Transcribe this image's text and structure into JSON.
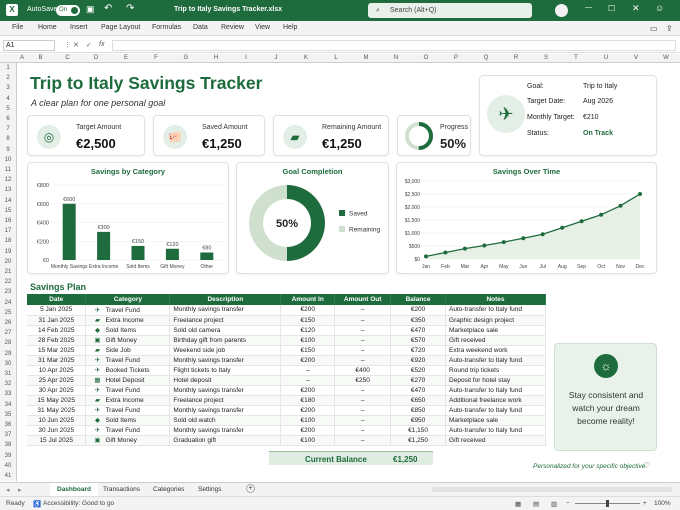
{
  "titlebar": {
    "autosave_label": "AutoSave",
    "autosave_state": "On",
    "file_name": "Trip to Italy Savings Tracker.xlsx",
    "search_placeholder": "Search (Alt+Q)"
  },
  "ribbon": {
    "tabs": [
      "File",
      "Home",
      "Insert",
      "Page Layout",
      "Formulas",
      "Data",
      "Review",
      "View",
      "Help"
    ]
  },
  "formula_bar": {
    "cell_ref": "A1",
    "fx": "fx"
  },
  "columns": [
    "A",
    "B",
    "C",
    "D",
    "E",
    "F",
    "G",
    "H",
    "I",
    "J",
    "K",
    "L",
    "M",
    "N",
    "O",
    "P",
    "Q",
    "R",
    "S",
    "T",
    "U",
    "V",
    "W",
    "X",
    "Y"
  ],
  "rows": [
    "1",
    "2",
    "3",
    "4",
    "5",
    "6",
    "7",
    "8",
    "9",
    "10",
    "11",
    "12",
    "13",
    "14",
    "15",
    "16",
    "17",
    "18",
    "19",
    "20",
    "21",
    "22",
    "23",
    "24",
    "25",
    "26",
    "27",
    "28",
    "29",
    "30",
    "31",
    "32",
    "33",
    "34",
    "35",
    "36",
    "37",
    "38",
    "39",
    "40",
    "41"
  ],
  "header": {
    "title": "Trip to Italy Savings Tracker",
    "subtitle": "A clear plan for one personal goal"
  },
  "kpis": [
    {
      "label": "Target Amount",
      "value": "€2,500",
      "icon": "target-icon"
    },
    {
      "label": "Saved Amount",
      "value": "€1,250",
      "icon": "piggy-bank-icon"
    },
    {
      "label": "Remaining Amount",
      "value": "€1,250",
      "icon": "wallet-icon"
    }
  ],
  "progress": {
    "label": "Progress",
    "value": "50%",
    "fraction": 0.5
  },
  "goal_info": {
    "icon": "airplane-icon",
    "rows": [
      {
        "label": "Goal:",
        "value": "Trip to Italy"
      },
      {
        "label": "Target Date:",
        "value": "Aug 2026"
      },
      {
        "label": "Monthly Target:",
        "value": "€210"
      },
      {
        "label": "Status:",
        "value": "On Track"
      }
    ]
  },
  "colors": {
    "brand": "#1e6b3d",
    "light": "#cfe0cf",
    "accent": "#2e7d32"
  },
  "chart_data": [
    {
      "type": "bar",
      "title": "Savings by Category",
      "categories": [
        "Monthly Savings",
        "Extra Income",
        "Sold Items",
        "Gift Money",
        "Other"
      ],
      "values": [
        600,
        300,
        150,
        120,
        80
      ],
      "data_labels": [
        "€600",
        "€300",
        "€150",
        "€120",
        "€80"
      ],
      "ylim": [
        0,
        800
      ],
      "yticks": [
        "€0",
        "€200",
        "€400",
        "€600",
        "€800"
      ]
    },
    {
      "type": "pie",
      "title": "Goal Completion",
      "center_label": "50%",
      "slices": [
        {
          "name": "Saved",
          "value": 50
        },
        {
          "name": "Remaining",
          "value": 50
        }
      ]
    },
    {
      "type": "line",
      "title": "Savings Over Time",
      "x": [
        "Jan",
        "Feb",
        "Mar",
        "Apr",
        "May",
        "Jun",
        "Jul",
        "Aug",
        "Sep",
        "Oct",
        "Nov",
        "Dec"
      ],
      "values": [
        100,
        250,
        400,
        520,
        650,
        800,
        950,
        1200,
        1450,
        1700,
        2050,
        2500
      ],
      "ylim": [
        0,
        3000
      ],
      "yticks": [
        "$0",
        "$500",
        "$1,000",
        "$1,500",
        "$2,000",
        "$2,500",
        "$3,000"
      ]
    }
  ],
  "plan": {
    "title": "Savings Plan",
    "headers": [
      "Date",
      "Category",
      "Description",
      "Amount In",
      "Amount Out",
      "Balance",
      "Notes"
    ],
    "rows": [
      [
        "5 Jan 2025",
        "Travel Fund",
        "Monthly savings transfer",
        "€200",
        "–",
        "€200",
        "Auto-transfer to Italy fund"
      ],
      [
        "31 Jan 2025",
        "Extra Income",
        "Freelance project",
        "€150",
        "–",
        "€350",
        "Graphic design project"
      ],
      [
        "14 Feb 2025",
        "Sold Items",
        "Sold old camera",
        "€120",
        "–",
        "€470",
        "Marketplace sale"
      ],
      [
        "28 Feb 2025",
        "Gift Money",
        "Birthday gift from parents",
        "€100",
        "–",
        "€570",
        "Gift received"
      ],
      [
        "15 Mar 2025",
        "Side Job",
        "Weekend side job",
        "€150",
        "–",
        "€720",
        "Extra weekend work"
      ],
      [
        "31 Mar 2025",
        "Travel Fund",
        "Monthly savings transfer",
        "€200",
        "–",
        "€920",
        "Auto-transfer to Italy fund"
      ],
      [
        "10 Apr 2025",
        "Booked Tickets",
        "Flight tickets to Italy",
        "–",
        "€400",
        "€520",
        "Round trip tickets"
      ],
      [
        "25 Apr 2025",
        "Hotel Deposit",
        "Hotel deposit",
        "–",
        "€250",
        "€270",
        "Deposit for hotel stay"
      ],
      [
        "30 Apr 2025",
        "Travel Fund",
        "Monthly savings transfer",
        "€200",
        "–",
        "€470",
        "Auto-transfer to Italy fund"
      ],
      [
        "15 May 2025",
        "Extra Income",
        "Freelance project",
        "€180",
        "–",
        "€650",
        "Additional freelance work"
      ],
      [
        "31 May 2025",
        "Travel Fund",
        "Monthly savings transfer",
        "€200",
        "–",
        "€850",
        "Auto-transfer to Italy fund"
      ],
      [
        "10 Jun 2025",
        "Sold Items",
        "Sold old watch",
        "€100",
        "–",
        "€950",
        "Marketplace sale"
      ],
      [
        "30 Jun 2025",
        "Travel Fund",
        "Monthly savings transfer",
        "€200",
        "–",
        "€1,150",
        "Auto-transfer to Italy fund"
      ],
      [
        "15 Jul 2025",
        "Gift Money",
        "Graduation gift",
        "€100",
        "–",
        "€1,250",
        "Gift received"
      ]
    ],
    "row_icons": [
      "airplane-icon",
      "briefcase-icon",
      "tag-icon",
      "gift-icon",
      "briefcase-icon",
      "airplane-icon",
      "airplane-icon",
      "hotel-icon",
      "airplane-icon",
      "briefcase-icon",
      "airplane-icon",
      "tag-icon",
      "airplane-icon",
      "gift-icon"
    ],
    "balance_label": "Current Balance",
    "balance_value": "€1,250"
  },
  "tip": {
    "text": "Stay consistent and watch your dream become reality!",
    "footer": "Personalized for your specific objective"
  },
  "sheet_tabs": [
    "Dashboard",
    "Transactions",
    "Categories",
    "Settings"
  ],
  "status": {
    "ready": "Ready",
    "accessibility": "Accessibility: Good to go",
    "zoom": "100%"
  }
}
